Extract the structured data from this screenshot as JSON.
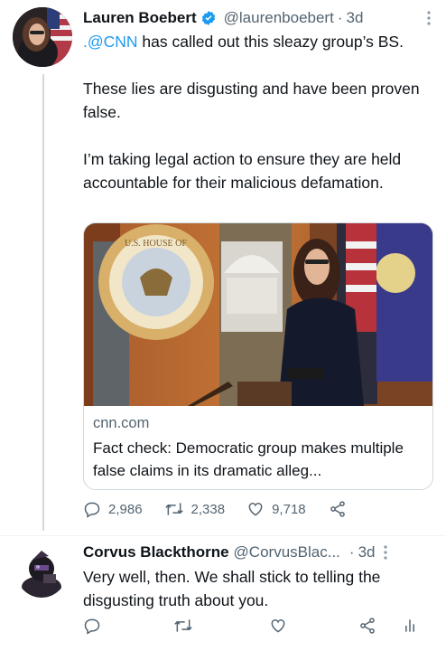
{
  "colors": {
    "accent": "#1d9bf0",
    "text": "#0f1419",
    "muted": "#536471",
    "border": "#cfd9de"
  },
  "tweet": {
    "author_name": "Lauren Boebert",
    "author_handle": "@laurenboebert",
    "separator": "·",
    "time": "3d",
    "verified_icon": "verified-badge-icon",
    "mention": ".@CNN",
    "line1_rest": " has called out this sleazy group’s BS.",
    "paragraph2": "These lies are disgusting and have been proven false.",
    "paragraph3": "I’m taking legal action to ensure they are held accountable for their malicious defamation.",
    "card": {
      "domain": "cnn.com",
      "title": "Fact check: Democratic group makes multiple false claims in its dramatic alleg...",
      "image_seal_text": "U.S. HOUSE OF REPRESENTATIVES"
    },
    "stats": {
      "replies": "2,986",
      "retweets": "2,338",
      "likes": "9,718"
    }
  },
  "reply": {
    "author_name": "Corvus Blackthorne",
    "author_handle": "@CorvusBlac...",
    "separator": "·",
    "time": "3d",
    "text": "Very well, then. We shall stick to telling the disgusting truth about you."
  }
}
